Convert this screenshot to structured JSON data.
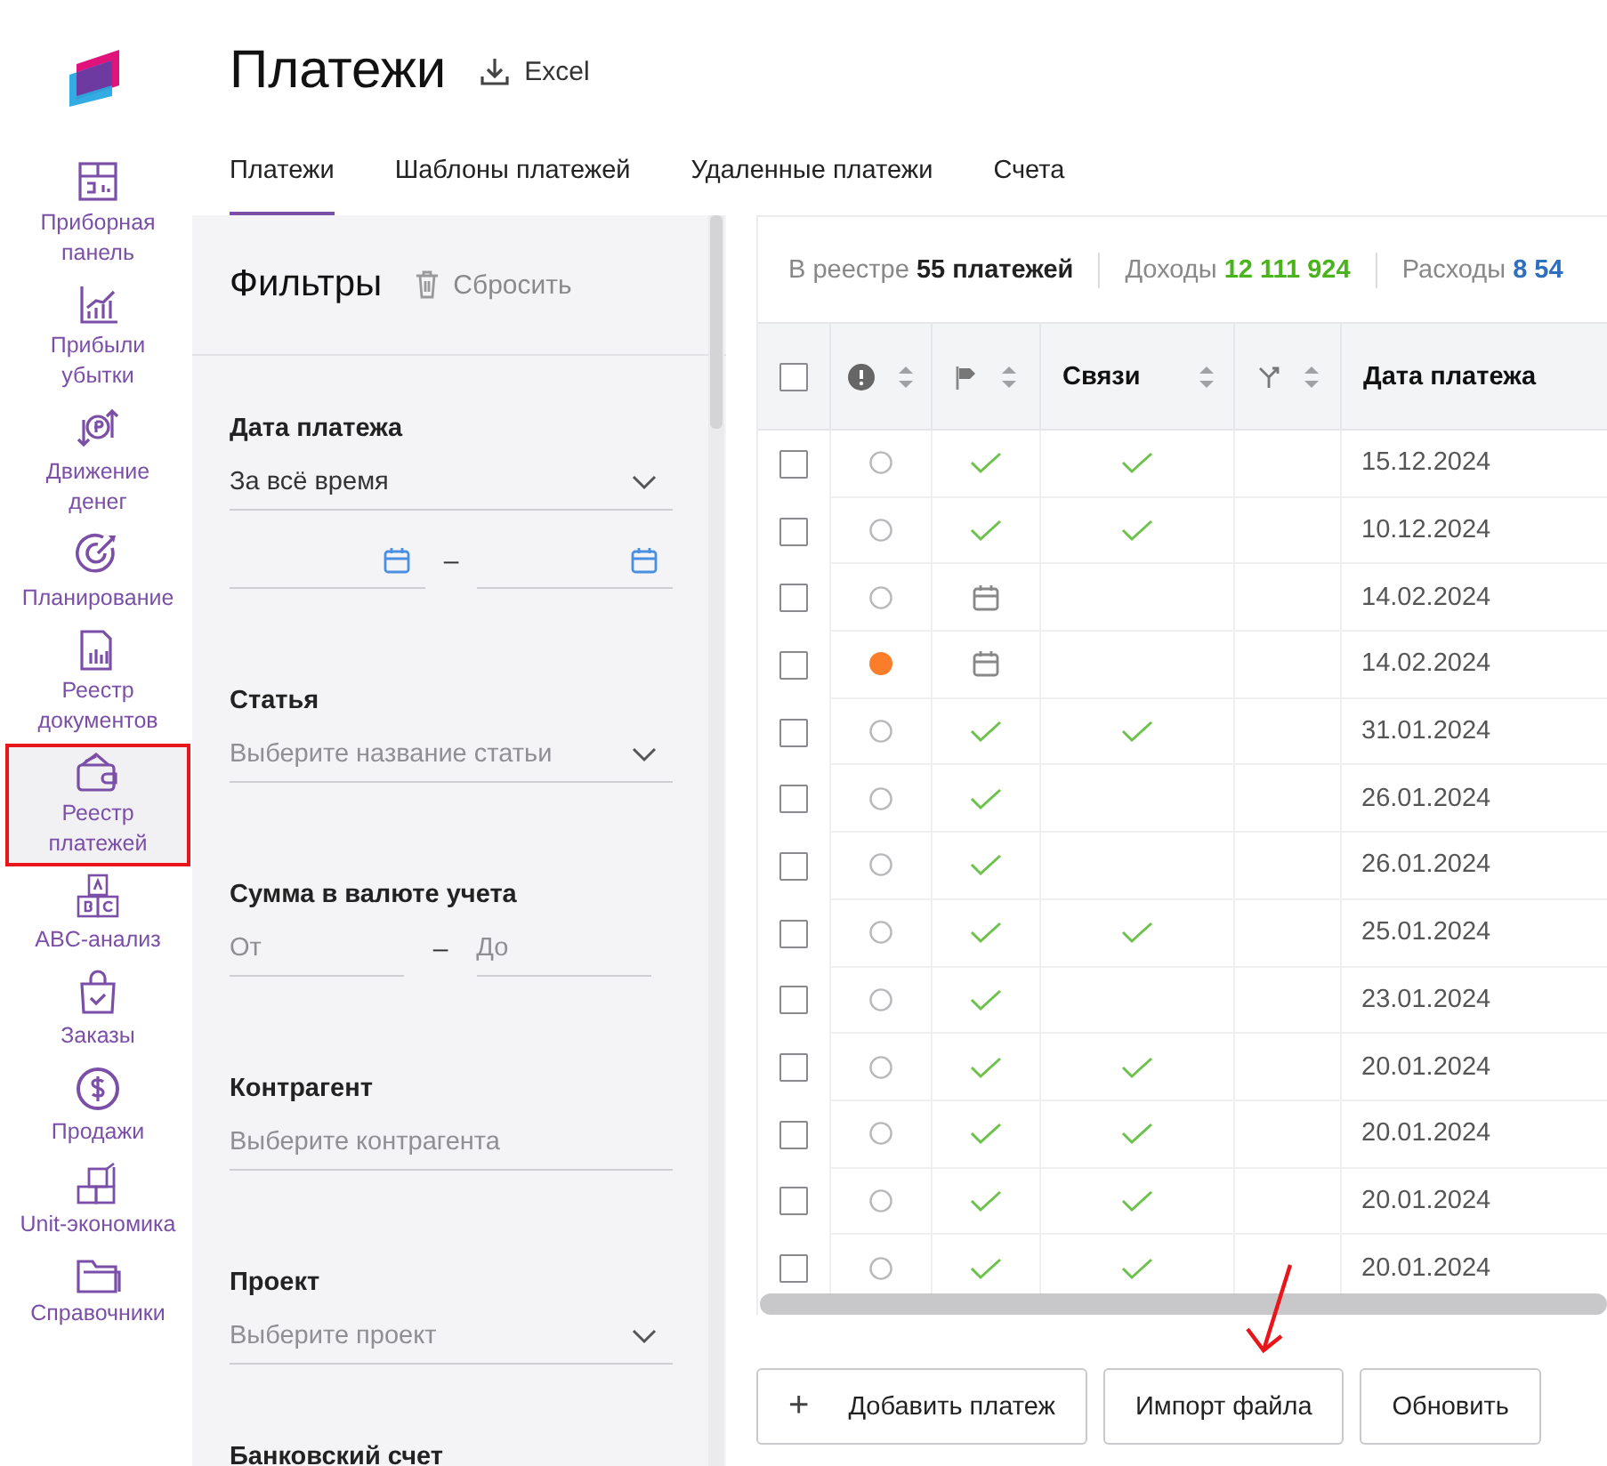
{
  "sidebar": {
    "items": [
      {
        "label": "Приборная\nпанель",
        "selected": false
      },
      {
        "label": "Прибыли\nубытки",
        "selected": false
      },
      {
        "label": "Движение\nденег",
        "selected": false
      },
      {
        "label": "Планирование",
        "selected": false
      },
      {
        "label": "Реестр\nдокументов",
        "selected": false
      },
      {
        "label": "Реестр\nплатежей",
        "selected": true
      },
      {
        "label": "ABC-анализ",
        "selected": false
      },
      {
        "label": "Заказы",
        "selected": false
      },
      {
        "label": "Продажи",
        "selected": false
      },
      {
        "label": "Unit-экономика",
        "selected": false
      },
      {
        "label": "Справочники",
        "selected": false
      }
    ]
  },
  "header": {
    "title": "Платежи",
    "export_label": "Excel"
  },
  "tabs": [
    {
      "label": "Платежи",
      "selected": true
    },
    {
      "label": "Шаблоны платежей",
      "selected": false
    },
    {
      "label": "Удаленные платежи",
      "selected": false
    },
    {
      "label": "Счета",
      "selected": false
    }
  ],
  "filters": {
    "title": "Фильтры",
    "reset_label": "Сбросить",
    "fields": [
      {
        "kind": "select",
        "label": "Дата платежа",
        "value": "За всё время"
      },
      {
        "kind": "date-range",
        "separator": "–"
      },
      {
        "kind": "select",
        "label": "Статья",
        "placeholder": "Выберите название статьи"
      },
      {
        "kind": "range",
        "label": "Сумма в валюте учета",
        "from_placeholder": "От",
        "separator": "–",
        "to_placeholder": "До"
      },
      {
        "kind": "text",
        "label": "Контрагент",
        "placeholder": "Выберите контрагента"
      },
      {
        "kind": "select",
        "label": "Проект",
        "placeholder": "Выберите проект"
      },
      {
        "kind": "heading",
        "label": "Банковский счет"
      }
    ]
  },
  "summary": [
    {
      "kind": "count",
      "text": "В реестре **55 платежей**"
    },
    {
      "kind": "income",
      "text": "Доходы **12 111 924**"
    },
    {
      "kind": "expense",
      "text": "Расходы **8 54**"
    }
  ],
  "table": {
    "columns": [
      {
        "kind": "checkbox",
        "checked": false
      },
      {
        "kind": "alert-icon"
      },
      {
        "kind": "flag-icon"
      },
      {
        "kind": "text",
        "label": "Связи"
      },
      {
        "kind": "branch-icon"
      },
      {
        "kind": "text",
        "label": "Дата платежа"
      }
    ],
    "rows": [
      {
        "checked": false,
        "alert": false,
        "scheduled": false,
        "linked": true,
        "date": "15.12.2024"
      },
      {
        "checked": false,
        "alert": false,
        "scheduled": false,
        "linked": true,
        "date": "10.12.2024"
      },
      {
        "checked": false,
        "alert": false,
        "scheduled": true,
        "linked": false,
        "date": "14.02.2024"
      },
      {
        "checked": false,
        "alert": true,
        "scheduled": true,
        "linked": false,
        "date": "14.02.2024"
      },
      {
        "checked": false,
        "alert": false,
        "scheduled": false,
        "linked": true,
        "date": "31.01.2024"
      },
      {
        "checked": false,
        "alert": false,
        "scheduled": false,
        "linked": false,
        "date": "26.01.2024"
      },
      {
        "checked": false,
        "alert": false,
        "scheduled": false,
        "linked": false,
        "date": "26.01.2024"
      },
      {
        "checked": false,
        "alert": false,
        "scheduled": false,
        "linked": true,
        "date": "25.01.2024"
      },
      {
        "checked": false,
        "alert": false,
        "scheduled": false,
        "linked": false,
        "date": "23.01.2024"
      },
      {
        "checked": false,
        "alert": false,
        "scheduled": false,
        "linked": true,
        "date": "20.01.2024"
      },
      {
        "checked": false,
        "alert": false,
        "scheduled": false,
        "linked": true,
        "date": "20.01.2024"
      },
      {
        "checked": false,
        "alert": false,
        "scheduled": false,
        "linked": true,
        "date": "20.01.2024"
      },
      {
        "checked": false,
        "alert": false,
        "scheduled": false,
        "linked": true,
        "date": "20.01.2024"
      }
    ]
  },
  "actions": [
    {
      "label": "Добавить платеж",
      "icon_text": "+"
    },
    {
      "label": "Импорт файла"
    },
    {
      "label": "Обновить"
    }
  ]
}
